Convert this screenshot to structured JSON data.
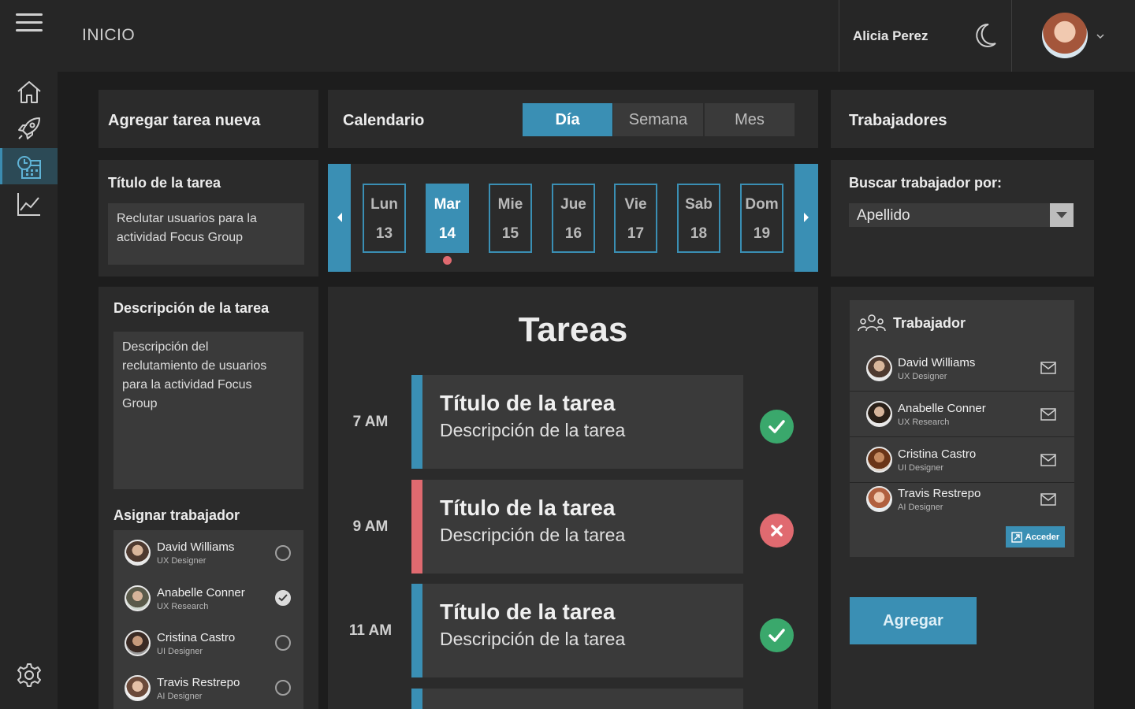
{
  "header": {
    "page_title": "INICIO",
    "user_name": "Alicia Perez"
  },
  "sidebar": {
    "items": [
      {
        "icon": "home-icon"
      },
      {
        "icon": "rocket-icon"
      },
      {
        "icon": "schedule-icon",
        "active": true
      },
      {
        "icon": "chart-icon"
      }
    ],
    "settings_icon": "gear-icon"
  },
  "new_task": {
    "title": "Agregar tarea nueva",
    "task_title_label": "Título de la tarea",
    "task_title_value": "Reclutar usuarios para la actividad Focus Group",
    "description_label": "Descripción de la tarea",
    "description_value": "Descripción del reclutamiento de usuarios para la actividad Focus Group",
    "assign_label": "Asignar trabajador",
    "assign_list": [
      {
        "name": "David Williams",
        "role": "UX Designer",
        "checked": false
      },
      {
        "name": "Anabelle Conner",
        "role": "UX Research",
        "checked": true
      },
      {
        "name": "Cristina Castro",
        "role": "UI Designer",
        "checked": false
      },
      {
        "name": "Travis Restrepo",
        "role": "AI Designer",
        "checked": false
      }
    ]
  },
  "calendar": {
    "title": "Calendario",
    "views": [
      "Día",
      "Semana",
      "Mes"
    ],
    "active_view": "Día",
    "days": [
      {
        "name": "Lun",
        "num": "13"
      },
      {
        "name": "Mar",
        "num": "14",
        "active": true
      },
      {
        "name": "Mie",
        "num": "15"
      },
      {
        "name": "Jue",
        "num": "16"
      },
      {
        "name": "Vie",
        "num": "17"
      },
      {
        "name": "Sab",
        "num": "18"
      },
      {
        "name": "Dom",
        "num": "19"
      }
    ]
  },
  "tasks": {
    "title": "Tareas",
    "items": [
      {
        "time": "7 AM",
        "title": "Título de la tarea",
        "desc": "Descripción de la tarea",
        "status": "done"
      },
      {
        "time": "9 AM",
        "title": "Título de la tarea",
        "desc": "Descripción de la tarea",
        "status": "rejected"
      },
      {
        "time": "11 AM",
        "title": "Título de la tarea",
        "desc": "Descripción de la tarea",
        "status": "done"
      }
    ]
  },
  "workers": {
    "title": "Trabajadores",
    "search_label": "Buscar trabajador por:",
    "search_by": "Apellido",
    "list_title": "Trabajador",
    "list": [
      {
        "name": "David Williams",
        "role": "UX Designer"
      },
      {
        "name": "Anabelle Conner",
        "role": "UX Research"
      },
      {
        "name": "Cristina Castro",
        "role": "UI Designer"
      },
      {
        "name": "Travis Restrepo",
        "role": "AI Designer"
      }
    ],
    "access_label": "Acceder",
    "add_label": "Agregar"
  },
  "colors": {
    "accent": "#3a8fb4",
    "danger": "#e06a70",
    "success": "#3aa86c",
    "panel": "#2b2b2b",
    "background": "#1d1d1d"
  }
}
